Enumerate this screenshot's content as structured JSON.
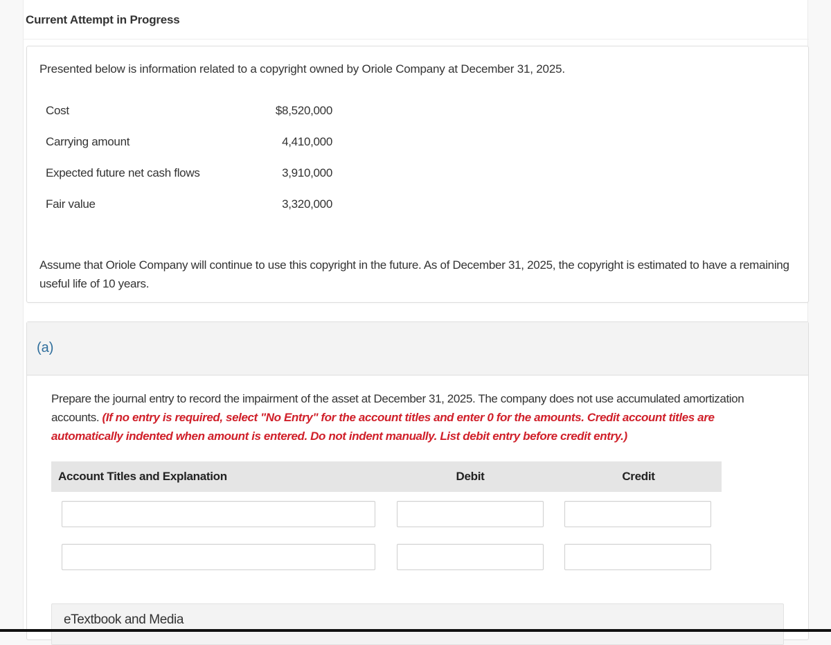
{
  "header": {
    "title": "Current Attempt in Progress"
  },
  "question": {
    "intro": "Presented below is information related to a copyright owned by Oriole Company at December 31, 2025.",
    "data_rows": [
      {
        "label": "Cost",
        "value": "$8,520,000"
      },
      {
        "label": "Carrying amount",
        "value": "4,410,000"
      },
      {
        "label": "Expected future net cash flows",
        "value": "3,910,000"
      },
      {
        "label": "Fair value",
        "value": "3,320,000"
      }
    ],
    "assumption": "Assume that Oriole Company will continue to use this copyright in the future. As of December 31, 2025, the copyright is estimated to have a remaining useful life of 10 years."
  },
  "part_a": {
    "label": "(a)",
    "instruction": "Prepare the journal entry to record the impairment of the asset at December 31, 2025. The company does not use accumulated amortization accounts.",
    "note": "(If no entry is required, select \"No Entry\" for the account titles and enter 0 for the amounts. Credit account titles are automatically indented when amount is entered. Do not indent manually. List debit entry before credit entry.)",
    "table": {
      "headers": {
        "account": "Account Titles and Explanation",
        "debit": "Debit",
        "credit": "Credit"
      },
      "rows": [
        {
          "account": "",
          "debit": "",
          "credit": ""
        },
        {
          "account": "",
          "debit": "",
          "credit": ""
        }
      ]
    },
    "etextbook_label": "eTextbook and Media"
  },
  "colors": {
    "part_label": "#2f6e9c",
    "note_red": "#d0202a",
    "header_gray": "#e5e5e5"
  }
}
